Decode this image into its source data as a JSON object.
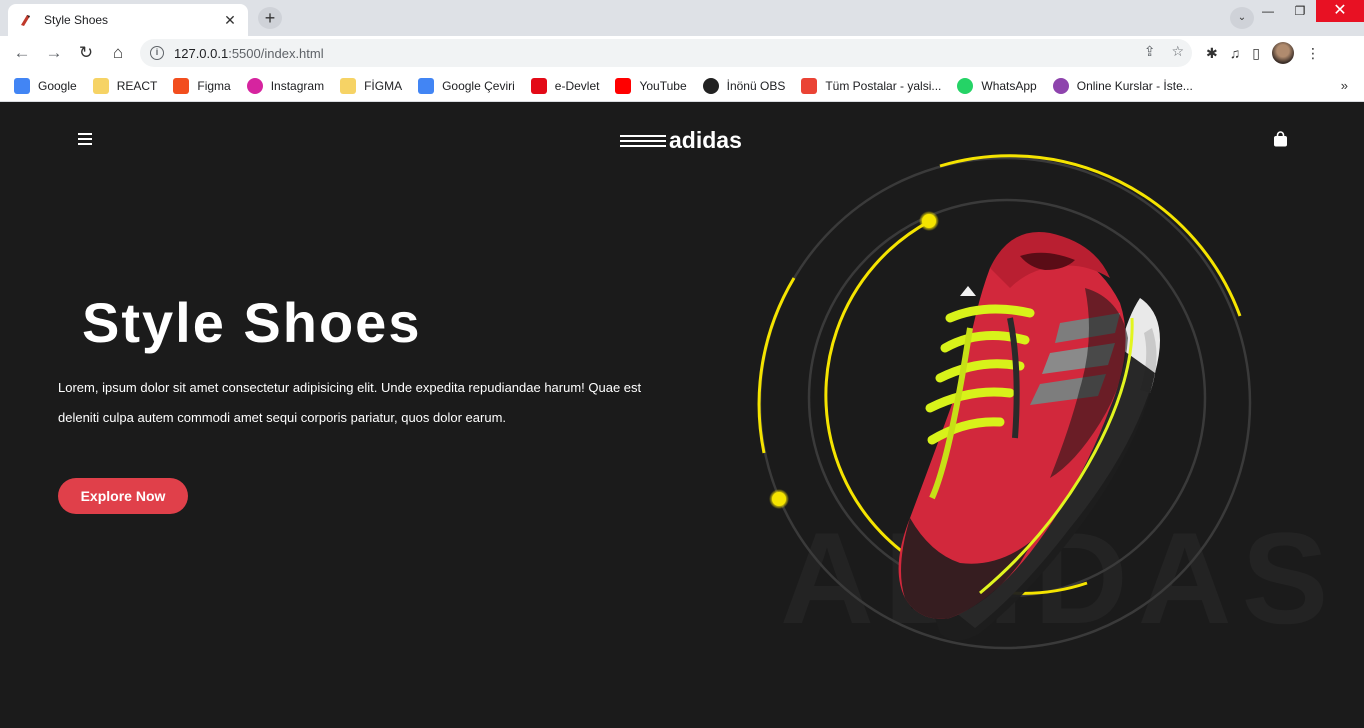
{
  "browser": {
    "tab_title": "Style Shoes",
    "url_host": "127.0.0.1",
    "url_rest": ":5500/index.html",
    "bookmarks": [
      {
        "label": "Google",
        "icon": "google-icon",
        "color": "#4285f4"
      },
      {
        "label": "REACT",
        "icon": "folder-icon",
        "color": "#f6d365"
      },
      {
        "label": "Figma",
        "icon": "figma-icon",
        "color": "#f24e1e"
      },
      {
        "label": "Instagram",
        "icon": "instagram-icon",
        "color": "#d6249f"
      },
      {
        "label": "FİGMA",
        "icon": "folder-icon",
        "color": "#f6d365"
      },
      {
        "label": "Google Çeviri",
        "icon": "translate-icon",
        "color": "#4285f4"
      },
      {
        "label": "e-Devlet",
        "icon": "edevlet-icon",
        "color": "#e30a17"
      },
      {
        "label": "YouTube",
        "icon": "youtube-icon",
        "color": "#ff0000"
      },
      {
        "label": "İnönü OBS",
        "icon": "globe-icon",
        "color": "#222222"
      },
      {
        "label": "Tüm Postalar - yalsi...",
        "icon": "gmail-icon",
        "color": "#ea4335"
      },
      {
        "label": "WhatsApp",
        "icon": "whatsapp-icon",
        "color": "#25d366"
      },
      {
        "label": "Online Kurslar - İste...",
        "icon": "course-icon",
        "color": "#8e44ad"
      }
    ],
    "more_label": "»"
  },
  "page": {
    "logo_text": "adidas",
    "hero_title": "Style Shoes",
    "hero_text": "Lorem, ipsum dolor sit amet consectetur adipisicing elit. Unde expedita repudiandae harum! Quae est deleniti culpa autem commodi amet sequi corporis pariatur, quos dolor earum.",
    "cta_label": "Explore Now",
    "bg_word": "ADIDAS",
    "colors": {
      "accent": "#e0404a",
      "ring": "#f5e400",
      "background": "#1b1b1b"
    }
  }
}
